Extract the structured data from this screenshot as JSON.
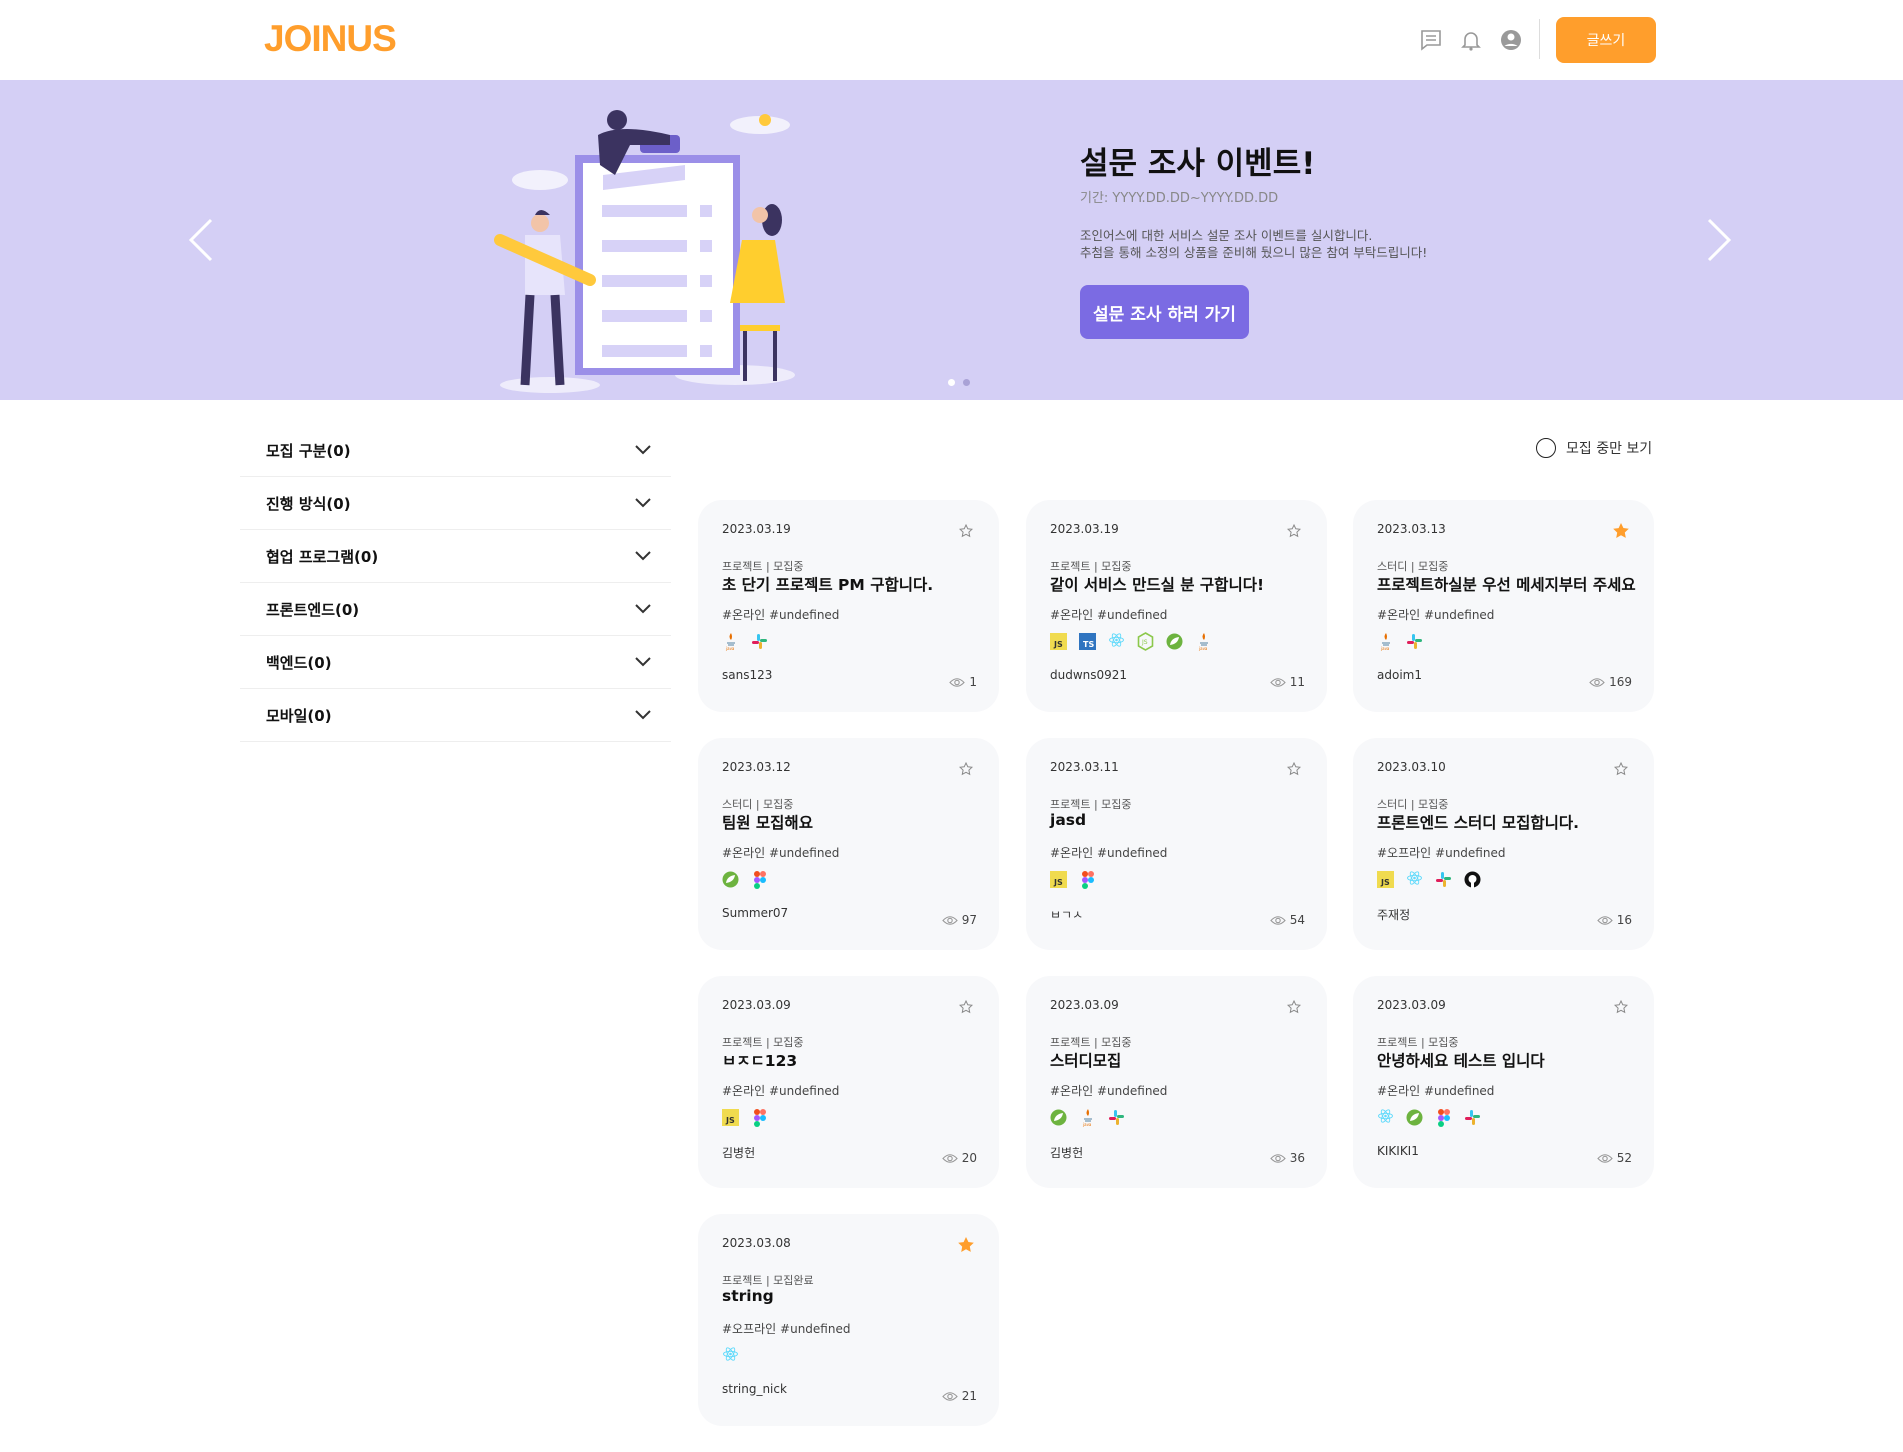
{
  "header": {
    "logo": "JOINUS",
    "icons": [
      "chat-icon",
      "bell-icon",
      "user-icon"
    ],
    "write_label": "글쓰기",
    "accent": "#ff9e2c"
  },
  "banner": {
    "title": "설문 조사 이벤트!",
    "period": "기간: YYYY.DD.DD~YYYY.DD.DD",
    "desc1": "조인어스에 대한 서비스 설문 조사 이벤트를 실시합니다.",
    "desc2": "추첨을 통해 소정의 상품을 준비해 뒀으니 많은 참여 부탁드립니다!",
    "button": "설문 조사 하러 가기",
    "bg": "#d4cff5",
    "button_color": "#7b6be3",
    "slide_count": 2,
    "active_slide": 1
  },
  "filters": [
    {
      "label": "모집 구분(0)"
    },
    {
      "label": "진행 방식(0)"
    },
    {
      "label": "협업 프로그램(0)"
    },
    {
      "label": "프론트엔드(0)"
    },
    {
      "label": "백엔드(0)"
    },
    {
      "label": "모바일(0)"
    }
  ],
  "toggle": {
    "label": "모집 중만 보기",
    "checked": false
  },
  "cards": [
    {
      "date": "2023.03.19",
      "category": "프로젝트 | 모집중",
      "title": "초 단기 프로젝트 PM 구합니다.",
      "tags": "#온라인 #undefined",
      "stack": [
        "java",
        "slack"
      ],
      "user": "sans123",
      "views": "1",
      "starred": false
    },
    {
      "date": "2023.03.19",
      "category": "프로젝트 | 모집중",
      "title": "같이 서비스 만드실 분 구합니다!",
      "tags": "#온라인 #undefined",
      "stack": [
        "js",
        "ts",
        "react",
        "node",
        "spring",
        "java"
      ],
      "user": "dudwns0921",
      "views": "11",
      "starred": false
    },
    {
      "date": "2023.03.13",
      "category": "스터디 | 모집중",
      "title": "프로젝트하실분 우선 메세지부터 주세요",
      "tags": "#온라인 #undefined",
      "stack": [
        "java",
        "slack"
      ],
      "user": "adoim1",
      "views": "169",
      "starred": true
    },
    {
      "date": "2023.03.12",
      "category": "스터디 | 모집중",
      "title": "팀원 모집해요",
      "tags": "#온라인 #undefined",
      "stack": [
        "spring",
        "figma"
      ],
      "user": "Summer07",
      "views": "97",
      "starred": false
    },
    {
      "date": "2023.03.11",
      "category": "프로젝트 | 모집중",
      "title": "jasd",
      "tags": "#온라인 #undefined",
      "stack": [
        "js",
        "figma"
      ],
      "user": "ㅂㄱㅅ",
      "views": "54",
      "starred": false
    },
    {
      "date": "2023.03.10",
      "category": "스터디 | 모집중",
      "title": "프론트엔드 스터디 모집합니다.",
      "tags": "#오프라인 #undefined",
      "stack": [
        "js",
        "react",
        "slack",
        "github"
      ],
      "user": "주재정",
      "views": "16",
      "starred": false
    },
    {
      "date": "2023.03.09",
      "category": "프로젝트 | 모집중",
      "title": "ㅂㅈㄷ123",
      "tags": "#온라인 #undefined",
      "stack": [
        "js",
        "figma"
      ],
      "user": "김병헌",
      "views": "20",
      "starred": false
    },
    {
      "date": "2023.03.09",
      "category": "프로젝트 | 모집중",
      "title": "스터디모집",
      "tags": "#온라인 #undefined",
      "stack": [
        "spring",
        "java",
        "slack"
      ],
      "user": "김병헌",
      "views": "36",
      "starred": false
    },
    {
      "date": "2023.03.09",
      "category": "프로젝트 | 모집중",
      "title": "안녕하세요 테스트 입니다",
      "tags": "#온라인 #undefined",
      "stack": [
        "react",
        "spring",
        "figma",
        "slack"
      ],
      "user": "KIKIKI1",
      "views": "52",
      "starred": false
    },
    {
      "date": "2023.03.08",
      "category": "프로젝트 | 모집완료",
      "title": "string",
      "tags": "#오프라인 #undefined",
      "stack": [
        "react"
      ],
      "user": "string_nick",
      "views": "21",
      "starred": true
    }
  ]
}
